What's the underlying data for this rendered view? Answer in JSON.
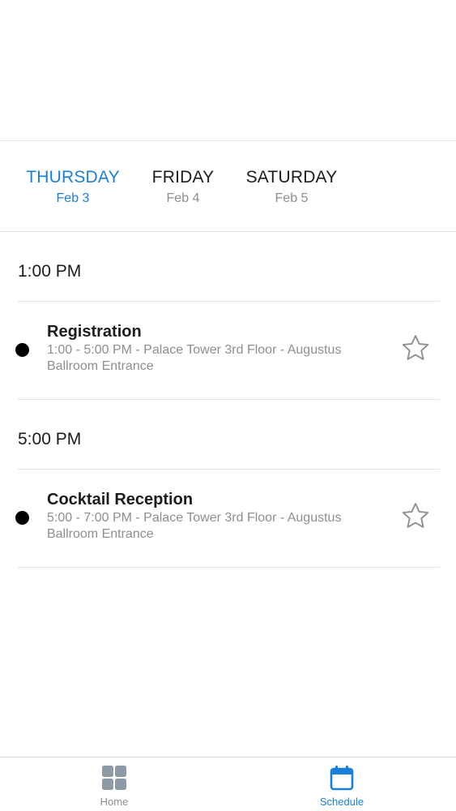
{
  "days": [
    {
      "name": "THURSDAY",
      "date": "Feb 3",
      "active": true
    },
    {
      "name": "FRIDAY",
      "date": "Feb 4",
      "active": false
    },
    {
      "name": "SATURDAY",
      "date": "Feb 5",
      "active": false
    }
  ],
  "schedule": [
    {
      "time": "1:00 PM",
      "sessions": [
        {
          "title": "Registration",
          "detail": "1:00 - 5:00 PM - Palace Tower 3rd Floor - Augustus Ballroom Entrance",
          "favorited": false,
          "icon": "star-outline-icon"
        }
      ]
    },
    {
      "time": "5:00 PM",
      "sessions": [
        {
          "title": "Cocktail Reception",
          "detail": "5:00 - 7:00 PM - Palace Tower 3rd Floor - Augustus Ballroom Entrance",
          "favorited": false,
          "icon": "star-outline-icon"
        }
      ]
    }
  ],
  "tab_bar": {
    "items": [
      {
        "label": "Home",
        "icon": "grid-icon",
        "active": false
      },
      {
        "label": "Schedule",
        "icon": "calendar-icon",
        "active": true
      }
    ]
  },
  "colors": {
    "accent": "#1a7fd6",
    "secondary_text": "#8e8e93",
    "primary_text": "#1c1c1e",
    "inactive_icon": "#8e9aa6"
  }
}
